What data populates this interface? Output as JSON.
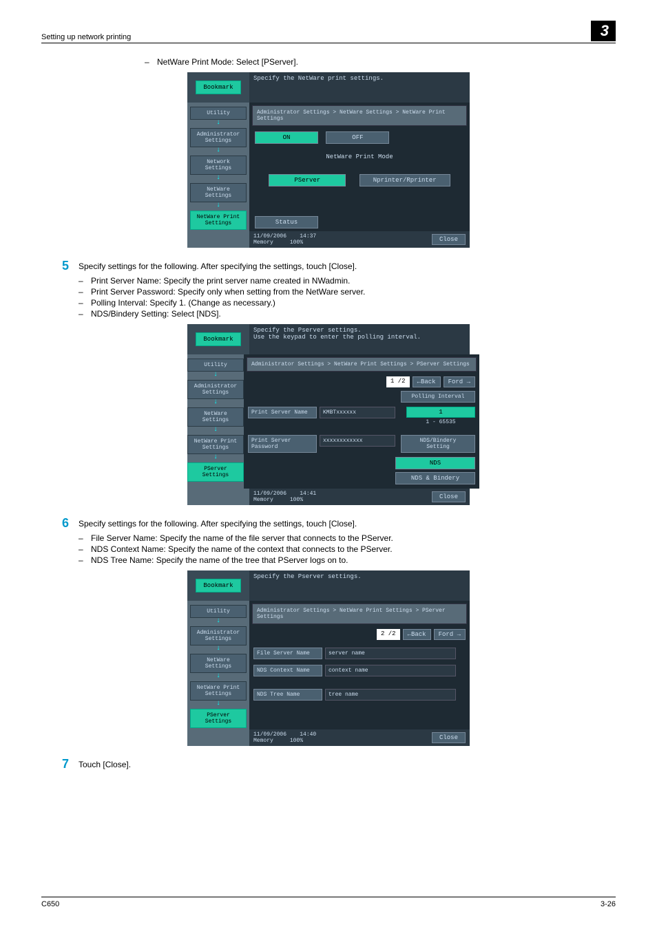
{
  "header": {
    "left": "Setting up network printing",
    "chapter": "3"
  },
  "line_top": "NetWare Print Mode: Select [PServer].",
  "panel1": {
    "title": "Specify the NetWare print settings.",
    "breadcrumb": "Administrator Settings > NetWare Settings > NetWare Print Settings",
    "on": "ON",
    "off": "OFF",
    "mode_label": "NetWare Print Mode",
    "opt1": "PServer",
    "opt2": "Nprinter/Rprinter",
    "status": "Status",
    "close": "Close",
    "foot_date": "11/09/2006",
    "foot_time": "14:37",
    "foot_mem": "Memory",
    "foot_pct": "100%",
    "side": {
      "bookmark": "Bookmark",
      "utility": "Utility",
      "admin": "Administrator\nSettings",
      "network": "Network\nSettings",
      "netware": "NetWare\nSettings",
      "netwareprint": "NetWare Print\nSettings"
    }
  },
  "step5": {
    "num": "5",
    "text": "Specify settings for the following. After specifying the settings, touch [Close].",
    "bullets": [
      "Print Server Name: Specify the print server name created in NWadmin.",
      "Print Server Password: Specify only when setting from the NetWare server.",
      "Polling Interval: Specify 1. (Change as necessary.)",
      "NDS/Bindery Setting: Select [NDS]."
    ]
  },
  "panel2": {
    "title1": "Specify the Pserver settings.",
    "title2": "Use the keypad to enter the polling interval.",
    "breadcrumb": "Administrator Settings > NetWare Print Settings > PServer Settings",
    "page": "1 /2",
    "back": "←Back",
    "fwd": "Ford →",
    "poll_label": "Polling Interval",
    "poll_val": "1",
    "poll_range": "1  -  65535",
    "psn_label": "Print Server Name",
    "psn_val": "KMBTxxxxxx",
    "psp_label": "Print Server\nPassword",
    "psp_val": "xxxxxxxxxxxx",
    "nds_label": "NDS/Bindery\nSetting",
    "nds_btn": "NDS",
    "ndsb_btn": "NDS & Bindery",
    "close": "Close",
    "foot_date": "11/09/2006",
    "foot_time": "14:41",
    "foot_mem": "Memory",
    "foot_pct": "100%",
    "side": {
      "bookmark": "Bookmark",
      "utility": "Utility",
      "admin": "Administrator\nSettings",
      "netware": "NetWare\nSettings",
      "netwareprint": "NetWare Print\nSettings",
      "pserver": "PServer Settings"
    }
  },
  "step6": {
    "num": "6",
    "text": "Specify settings for the following. After specifying the settings, touch [Close].",
    "bullets": [
      "File Server Name: Specify the name of the file server that connects to the PServer.",
      "NDS Context Name: Specify the name of the context that connects to the PServer.",
      "NDS Tree Name: Specify the name of the tree that PServer logs on to."
    ]
  },
  "panel3": {
    "title": "Specify the Pserver settings.",
    "breadcrumb": "Administrator Settings > NetWare Print Settings > PServer Settings",
    "page": "2 /2",
    "back": "←Back",
    "fwd": "Ford →",
    "fsn_label": "File Server Name",
    "fsn_val": "server name",
    "ncn_label": "NDS Context Name",
    "ncn_val": "context name",
    "ntn_label": "NDS Tree Name",
    "ntn_val": "tree name",
    "close": "Close",
    "foot_date": "11/09/2006",
    "foot_time": "14:40",
    "foot_mem": "Memory",
    "foot_pct": "100%",
    "side": {
      "bookmark": "Bookmark",
      "utility": "Utility",
      "admin": "Administrator\nSettings",
      "netware": "NetWare\nSettings",
      "netwareprint": "NetWare Print\nSettings",
      "pserver": "PServer Settings"
    }
  },
  "step7": {
    "num": "7",
    "text": "Touch [Close]."
  },
  "footer": {
    "left": "C650",
    "right": "3-26"
  }
}
